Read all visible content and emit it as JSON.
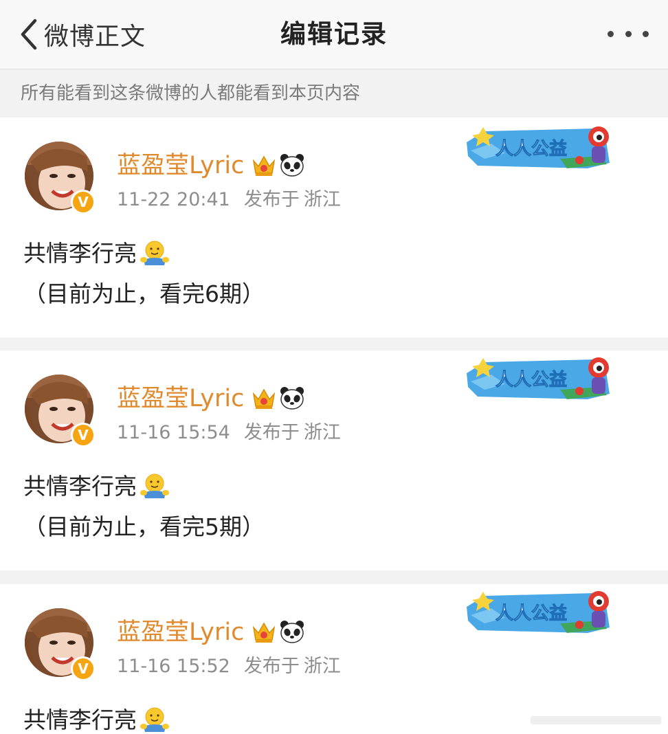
{
  "nav": {
    "back_label": "微博正文",
    "title": "编辑记录",
    "icons": {
      "back": "chevron-left-icon",
      "more": "more-dots-icon"
    }
  },
  "notice": "所有能看到这条微博的人都能看到本页内容",
  "colors": {
    "username": "#e08a2e",
    "meta": "#8d8d8d",
    "verified_badge": "#f4a511",
    "badge_blue": "#3a9fe0"
  },
  "badge": {
    "label": "人人公益"
  },
  "posts": [
    {
      "username": "蓝盈莹Lyric",
      "time": "11-22 20:41",
      "published": "发布于",
      "location": "浙江",
      "line1": "共情李行亮",
      "line2": "（目前为止，看完6期）"
    },
    {
      "username": "蓝盈莹Lyric",
      "time": "11-16 15:54",
      "published": "发布于",
      "location": "浙江",
      "line1": "共情李行亮",
      "line2": "（目前为止，看完5期）"
    },
    {
      "username": "蓝盈莹Lyric",
      "time": "11-16 15:52",
      "published": "发布于",
      "location": "浙江",
      "line1": "共情李行亮"
    }
  ]
}
